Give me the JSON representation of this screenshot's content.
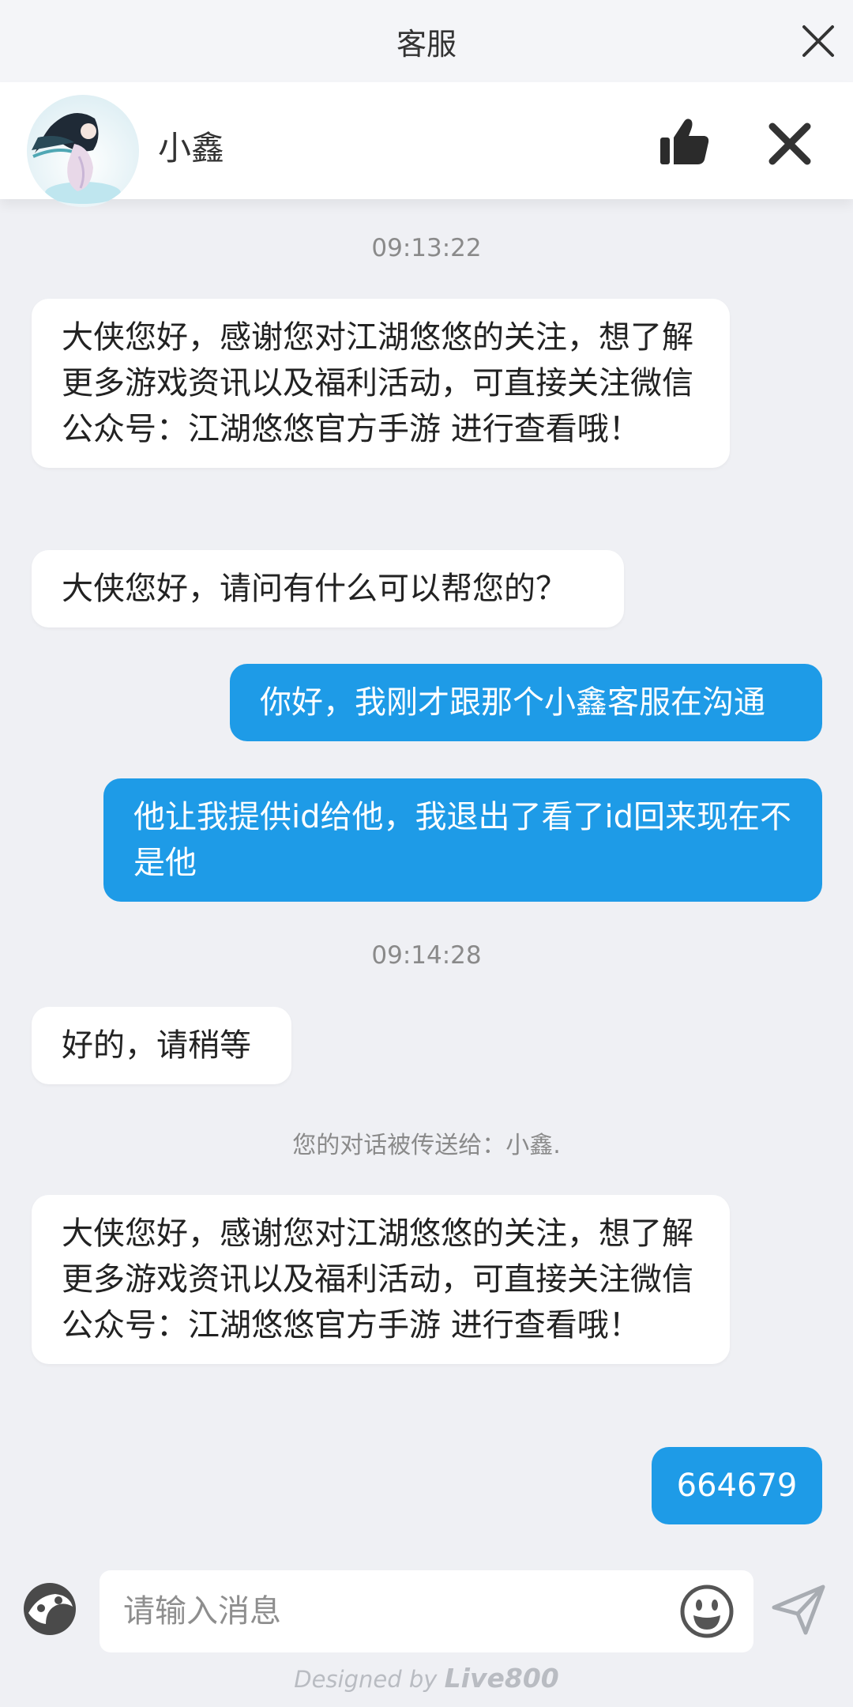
{
  "topbar": {
    "title": "客服"
  },
  "agent": {
    "name": "小鑫"
  },
  "messages": {
    "time1": "09:13:22",
    "m1": "大侠您好，感谢您对江湖悠悠的关注，想了解更多游戏资讯以及福利活动，可直接关注微信公众号：江湖悠悠官方手游 进行查看哦！",
    "m2": "大侠您好，请问有什么可以帮您的？",
    "u1": "你好，我刚才跟那个小鑫客服在沟通",
    "u2": "他让我提供id给他，我退出了看了id回来现在不是他",
    "time2": "09:14:28",
    "m3": "好的，请稍等",
    "notice": "您的对话被传送给：小鑫.",
    "m4": "大侠您好，感谢您对江湖悠悠的关注，想了解更多游戏资讯以及福利活动，可直接关注微信公众号：江湖悠悠官方手游 进行查看哦！",
    "u3": "664679"
  },
  "input": {
    "placeholder": "请输入消息"
  },
  "footer": {
    "prefix": "Designed by ",
    "brand": "Live800"
  },
  "colors": {
    "accent": "#1e9be7",
    "background": "#eff0f4"
  },
  "icons": [
    "close-icon",
    "thumbs-up-icon",
    "close-icon",
    "mascot-icon",
    "emoji-icon",
    "send-icon"
  ]
}
